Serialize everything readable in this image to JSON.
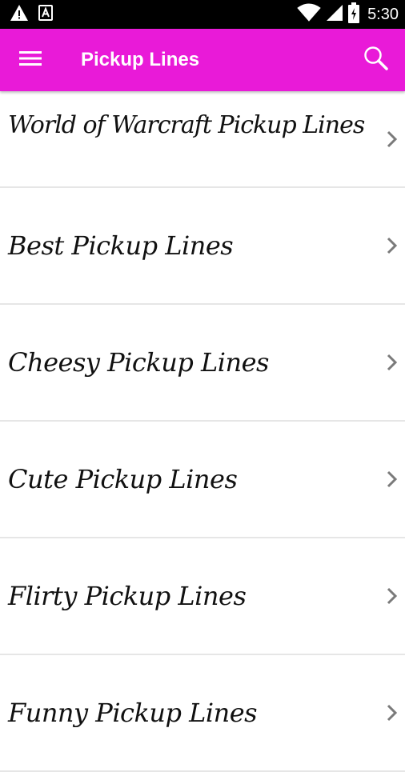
{
  "status_bar": {
    "time": "5:30",
    "icons": [
      "warning-icon",
      "notification-a-icon",
      "wifi-icon",
      "signal-icon",
      "battery-icon"
    ]
  },
  "app_bar": {
    "title": "Pickup Lines",
    "background_color": "#e91ad8",
    "menu_icon": "hamburger-menu-icon",
    "search_icon": "search-icon"
  },
  "list": {
    "items": [
      {
        "label": "World of Warcraft Pickup Lines"
      },
      {
        "label": "Best Pickup Lines"
      },
      {
        "label": "Cheesy Pickup Lines"
      },
      {
        "label": "Cute Pickup Lines"
      },
      {
        "label": "Flirty Pickup Lines"
      },
      {
        "label": "Funny Pickup Lines"
      }
    ],
    "chevron_icon": "chevron-right-icon"
  }
}
